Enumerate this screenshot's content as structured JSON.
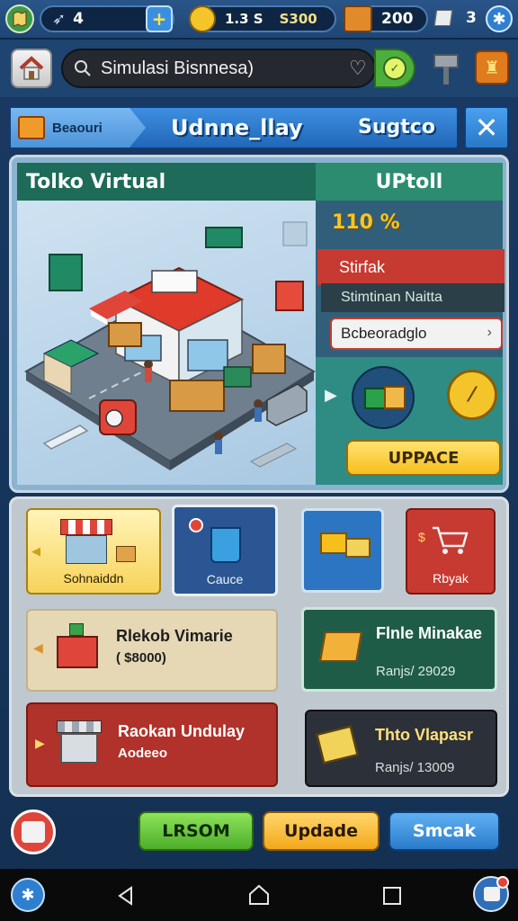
{
  "topbar": {
    "energy_value": "4",
    "coins_value": "1.3 S",
    "coins_secondary": "S300",
    "crates_value": "200",
    "tickets_value": "3"
  },
  "search": {
    "query": "Simulasi Bisnnesa)"
  },
  "title_bar": {
    "left_label": "Beaouri",
    "title": "Udnne_llay",
    "right_label": "Sugtco"
  },
  "main_card": {
    "store_title": "Tolko Virtual",
    "panel_title": "UPtoll",
    "percent": "110 %",
    "red_label": "Stirfak",
    "dark_label": "Stimtinan Naitta",
    "select_value": "Bcbeoradglo",
    "upgrade_label": "UPPACE"
  },
  "tiles": [
    {
      "label": "Sohnaiddn"
    },
    {
      "label": "Cauce"
    },
    {
      "label": ""
    },
    {
      "label": "Rbyak"
    }
  ],
  "list_cards": [
    {
      "title": "Rlekob Vimarie",
      "sub": "( $8000)"
    },
    {
      "title": "Flnle Minakae",
      "sub": "Ranjs/ 29029"
    },
    {
      "title": "Raokan Undulay",
      "sub": "Aodeeo"
    },
    {
      "title": "Thto Vlapasr",
      "sub": "Ranjs/ 13009"
    }
  ],
  "actions": {
    "lesson_label": "LRSOM",
    "update_label": "Updade",
    "smcak_label": "Smcak"
  },
  "colors": {
    "accent_yellow": "#f6bf1c",
    "accent_green": "#4caf3b",
    "accent_red": "#c73a31",
    "accent_blue": "#2a78c8"
  }
}
